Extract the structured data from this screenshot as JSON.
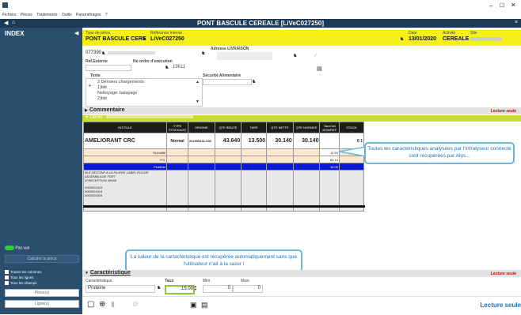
{
  "menu": [
    "Fichiers",
    "Pièces",
    "Traitements",
    "Outils",
    "Paramétrages",
    "?"
  ],
  "window_title": "PONT BASCULE CEREALE [LiVeC027250]",
  "sidebar": {
    "title": "INDEX",
    "toggle_label": "Pas vue",
    "compute_button": "Calculer la pièce",
    "options": [
      "Toutes les colonnes",
      "Tous les lignes",
      "Tous les champs"
    ],
    "btn1": "Pièce(s)",
    "btn2": "Ligne(s)"
  },
  "header": {
    "type_label": "Type de pièce",
    "type_value": "PONT BASCULE CERE",
    "ref_label": "Référence Interne",
    "ref_value": "LiVeC027250",
    "date_label": "Date",
    "date_value": "13/01/2020",
    "activity_label": "Activité",
    "activity_value": "CEREALE",
    "site_label": "Site"
  },
  "form": {
    "client_code": "077390",
    "delivery_label": "Adresse LIVRAISON",
    "ext_ref_label": "Réf.Externe",
    "exec_label": "No ordre d'exécution",
    "exec_value": "19611",
    "text_label": "Texte",
    "text_lines": [
      "3 Derniers chargements :",
      "1)blé",
      "Nettoyage: balayage",
      "2)blé"
    ],
    "food_safety_label": "Sécurité Alimentaire"
  },
  "commentaire": "Commentaire",
  "read_only": "Lecture seule",
  "detail": "Détail",
  "table": {
    "headers": [
      "INTITULE",
      "TYPE STOCKAGE",
      "ORIGINE",
      "QTE BRUTE",
      "TARE",
      "QTE NETTE",
      "QTE NORMEE",
      "Taux/Val BON/REF",
      "STOCK"
    ],
    "main_row": {
      "name": "AMELIORANT CRC",
      "type": "Normal",
      "origin": "201909131-000",
      "brute": "43.640",
      "tare": "13.500",
      "nette": "30.140",
      "normee": "30.140",
      "stock": "6 1"
    },
    "sub_rows": [
      {
        "name": "Humidité",
        "val": "12.50"
      },
      {
        "name": "P.S.",
        "val": "83.10"
      },
      {
        "name": "Protéine",
        "val": "15.00"
      }
    ],
    "notes": [
      "BLE DESTINE A LA FILIERE LABEL ROUGE",
      "ASSEMBLAGE FDRT",
      "N°RECEPTION 48660",
      "0000001913",
      "0000001914",
      "0000001915"
    ]
  },
  "bubble1": "Toutes les caractéristiques analysées par l'infralyseur connecté sont récupérées par Atys...",
  "bubble2": "La valeur de la cartactéristique est récupérée automatiquement sans que l'utilisateur n'ait à la saisir !",
  "caracteristique": {
    "title": "Caractéristique",
    "name_label": "Caractéristique",
    "name_value": "Protéine",
    "taux_label": "Taux",
    "taux_value": "15.00",
    "mini_label": "Mini",
    "mini_value": "0",
    "maxi_label": "Maxi",
    "maxi_value": "0",
    "read_only": "Lecture seule"
  },
  "footer_status": "Lecture seule",
  "colors": {
    "navy": "#1c3a55",
    "sidebar": "#2a4e6e",
    "yellow": "#f6f016",
    "lime": "#c8df2a",
    "selected": "#0a19d6",
    "bubble_border": "#6bb6de"
  }
}
